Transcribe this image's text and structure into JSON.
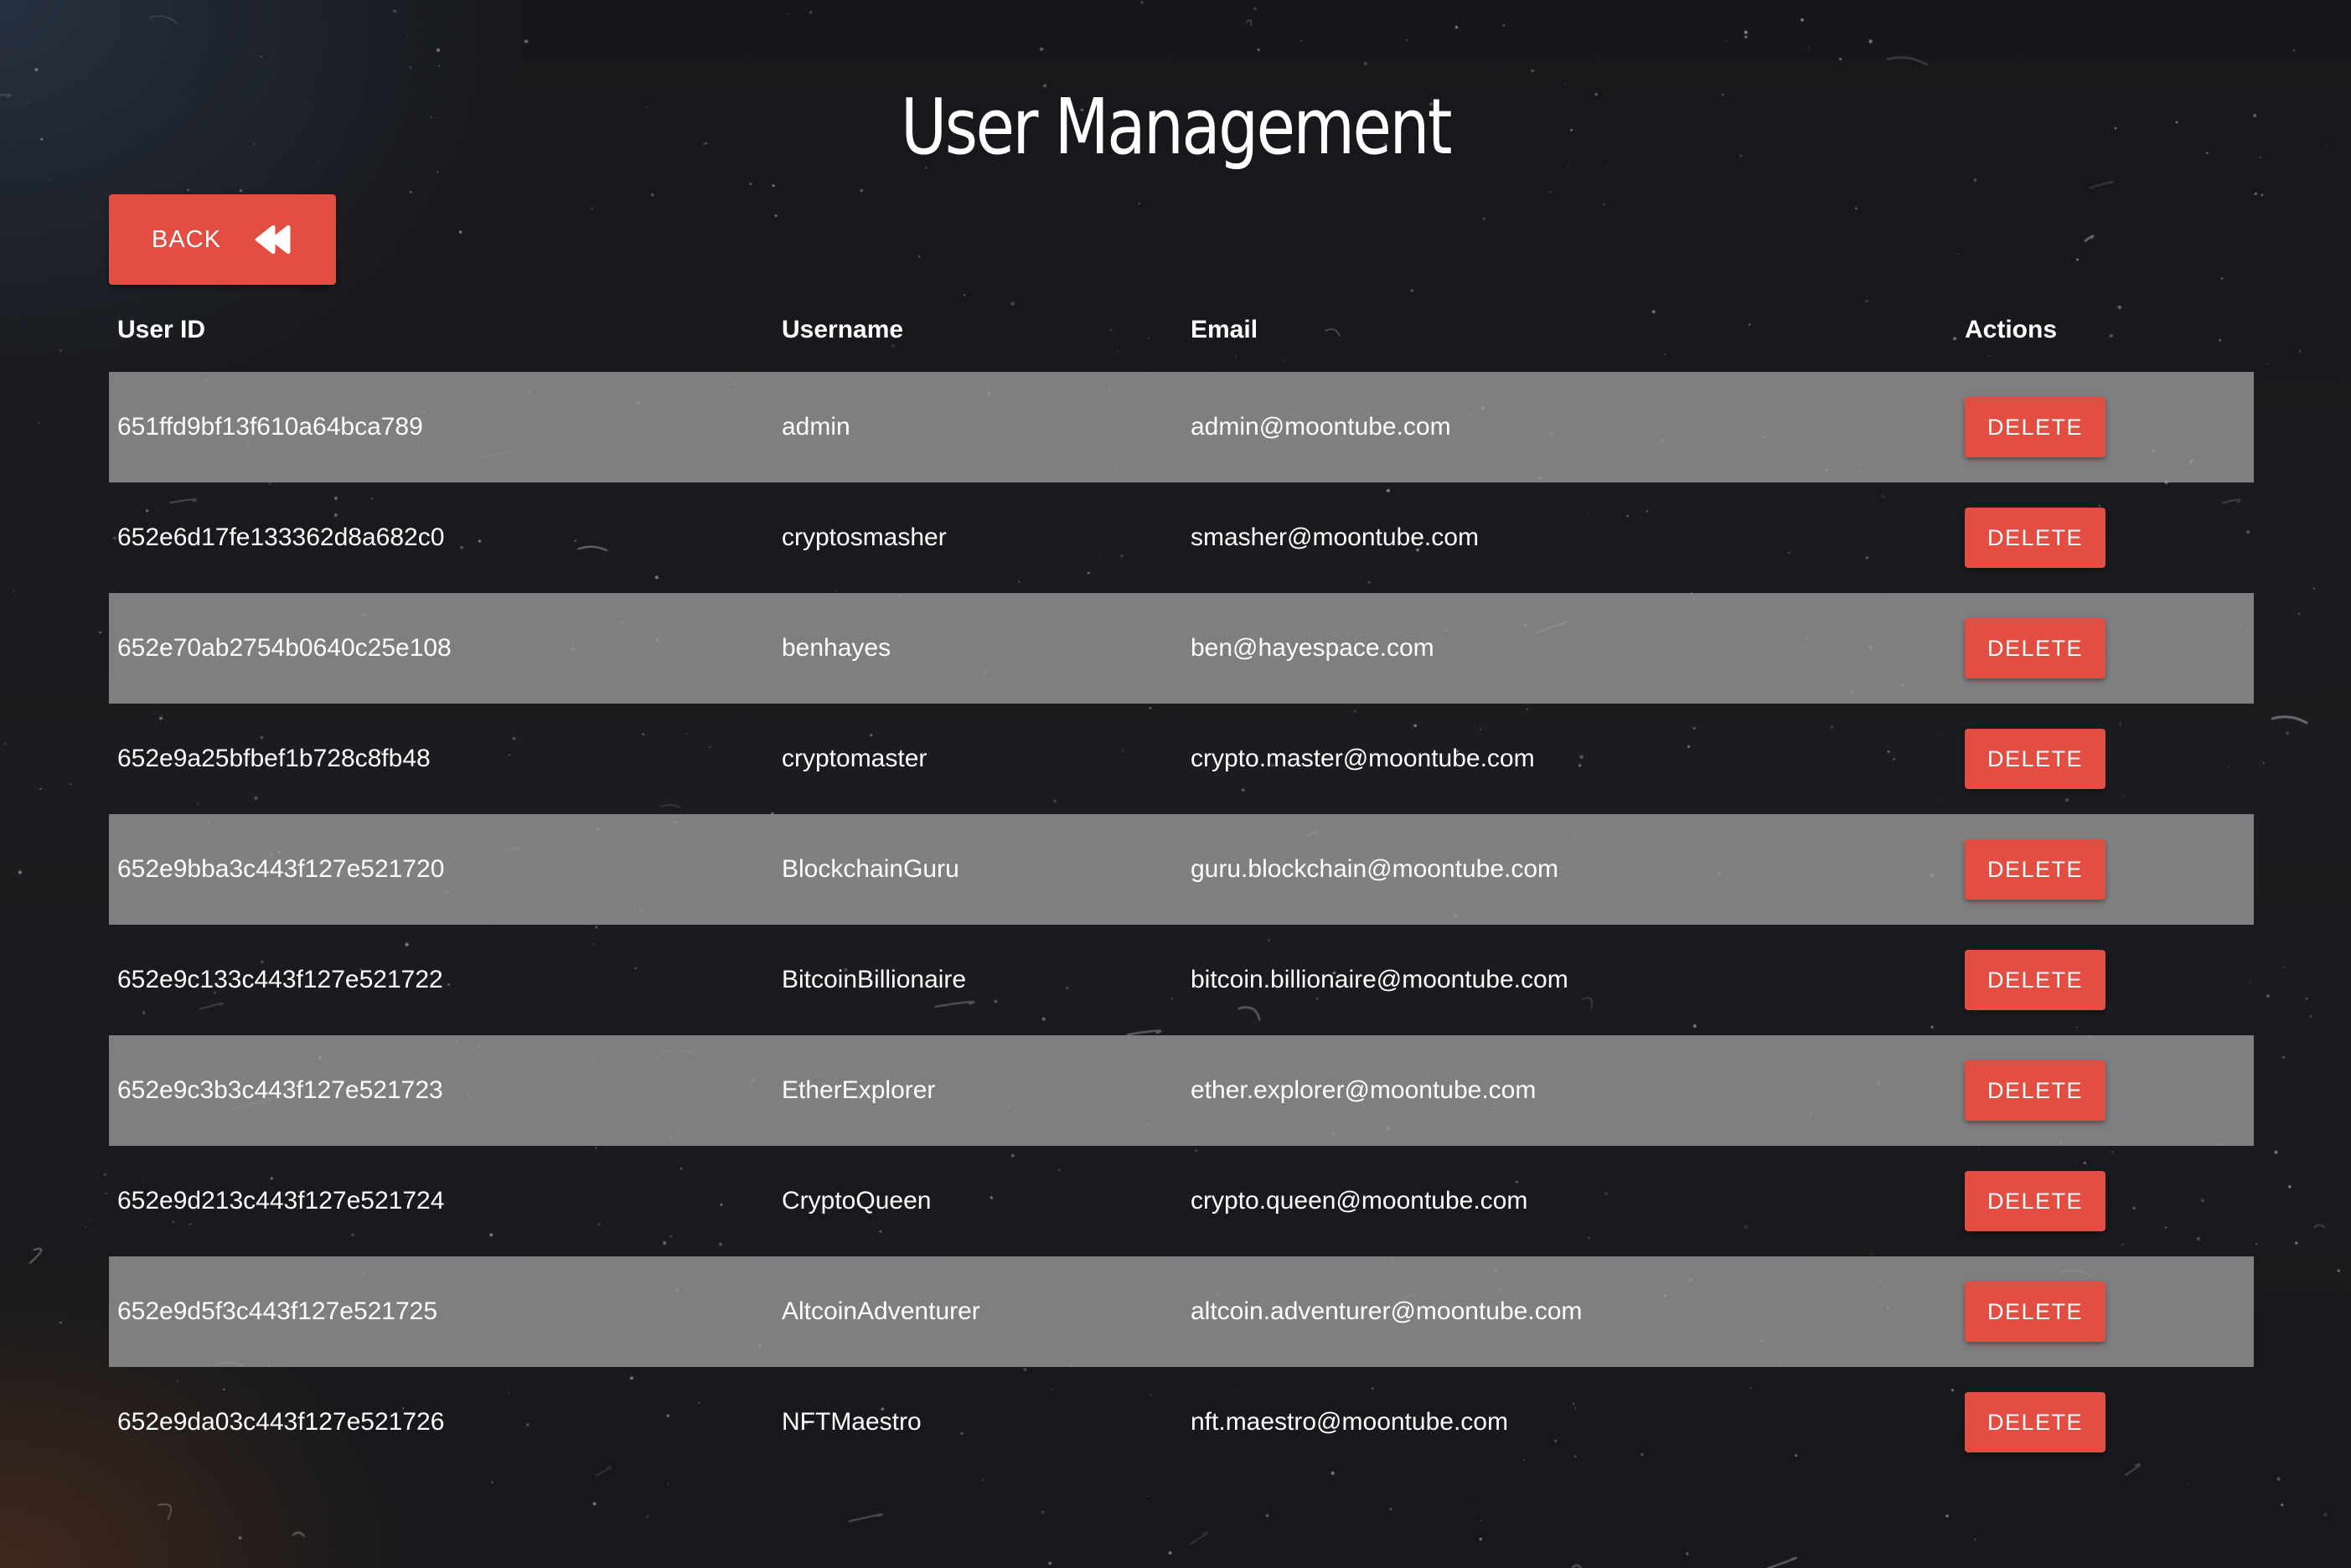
{
  "page": {
    "title": "User Management",
    "accent_color": "#e24e42",
    "row_shade_color": "#969698",
    "background_color": "#18191c"
  },
  "back_button": {
    "label": "BACK",
    "icon": "rewind-icon"
  },
  "table": {
    "headers": {
      "user_id": "User ID",
      "username": "Username",
      "email": "Email",
      "actions": "Actions"
    },
    "rows": [
      {
        "user_id": "651ffd9bf13f610a64bca789",
        "username": "admin",
        "email": "admin@moontube.com",
        "action": "DELETE"
      },
      {
        "user_id": "652e6d17fe133362d8a682c0",
        "username": "cryptosmasher",
        "email": "smasher@moontube.com",
        "action": "DELETE"
      },
      {
        "user_id": "652e70ab2754b0640c25e108",
        "username": "benhayes",
        "email": "ben@hayespace.com",
        "action": "DELETE"
      },
      {
        "user_id": "652e9a25bfbef1b728c8fb48",
        "username": "cryptomaster",
        "email": "crypto.master@moontube.com",
        "action": "DELETE"
      },
      {
        "user_id": "652e9bba3c443f127e521720",
        "username": "BlockchainGuru",
        "email": "guru.blockchain@moontube.com",
        "action": "DELETE"
      },
      {
        "user_id": "652e9c133c443f127e521722",
        "username": "BitcoinBillionaire",
        "email": "bitcoin.billionaire@moontube.com",
        "action": "DELETE"
      },
      {
        "user_id": "652e9c3b3c443f127e521723",
        "username": "EtherExplorer",
        "email": "ether.explorer@moontube.com",
        "action": "DELETE"
      },
      {
        "user_id": "652e9d213c443f127e521724",
        "username": "CryptoQueen",
        "email": "crypto.queen@moontube.com",
        "action": "DELETE"
      },
      {
        "user_id": "652e9d5f3c443f127e521725",
        "username": "AltcoinAdventurer",
        "email": "altcoin.adventurer@moontube.com",
        "action": "DELETE"
      },
      {
        "user_id": "652e9da03c443f127e521726",
        "username": "NFTMaestro",
        "email": "nft.maestro@moontube.com",
        "action": "DELETE"
      }
    ]
  }
}
